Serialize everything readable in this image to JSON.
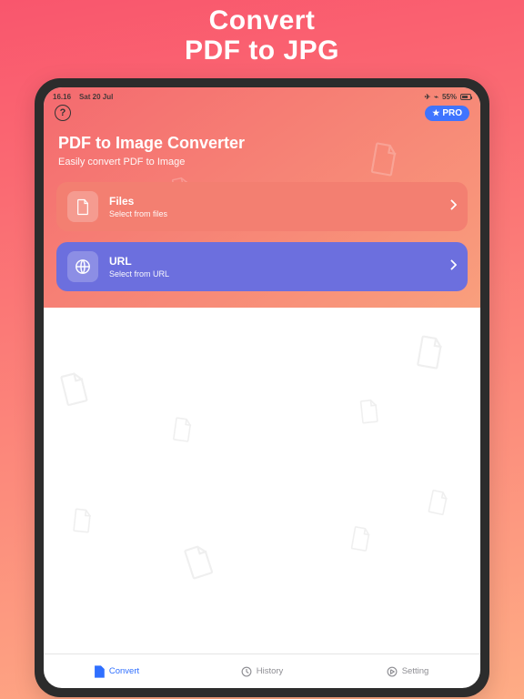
{
  "promo": {
    "line1": "Convert",
    "line2": "PDF to JPG"
  },
  "statusbar": {
    "time": "16.16",
    "date": "Sat 20 Jul",
    "battery": "55%"
  },
  "toprow": {
    "help": "?",
    "pro": "PRO"
  },
  "hero": {
    "title": "PDF to Image Converter",
    "subtitle": "Easily convert PDF to Image"
  },
  "cards": {
    "files": {
      "title": "Files",
      "subtitle": "Select from files"
    },
    "url": {
      "title": "URL",
      "subtitle": "Select from URL"
    }
  },
  "tabs": {
    "convert": "Convert",
    "history": "History",
    "setting": "Setting"
  }
}
